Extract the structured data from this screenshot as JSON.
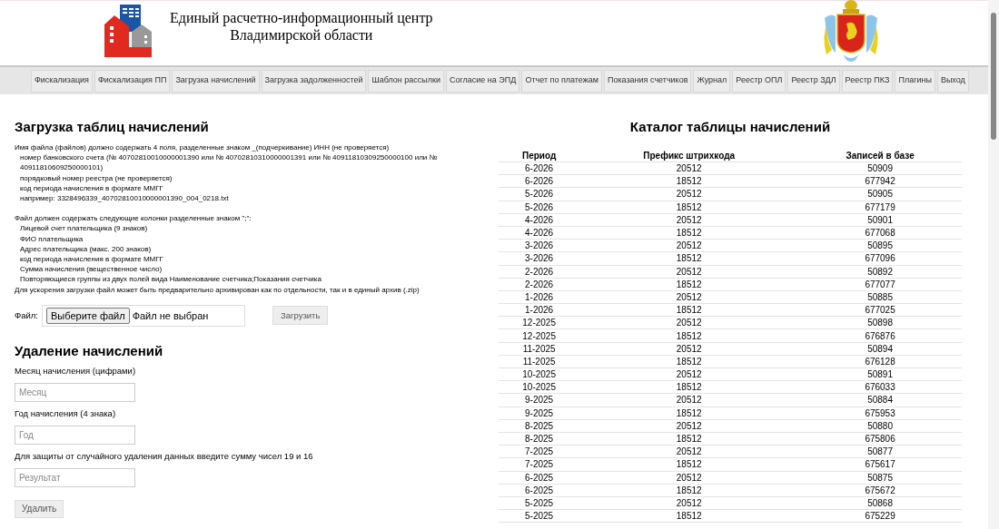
{
  "header": {
    "title_lines": [
      "Единый расчетно-информационный центр",
      "Владимирской области"
    ]
  },
  "nav": [
    {
      "label": "Фискализация"
    },
    {
      "label": "Фискализация ПП"
    },
    {
      "label": "Загрузка начислений"
    },
    {
      "label": "Загрузка задолженностей"
    },
    {
      "label": "Шаблон рассылки"
    },
    {
      "label": "Согласие на ЭПД"
    },
    {
      "label": "Отчет по платежам"
    },
    {
      "label": "Показания счетчиков"
    },
    {
      "label": "Журнал"
    },
    {
      "label": "Реестр ОПЛ"
    },
    {
      "label": "Реестр ЗДЛ"
    },
    {
      "label": "Реестр ПКЗ"
    },
    {
      "label": "Плагины"
    },
    {
      "label": "Выход"
    }
  ],
  "upload": {
    "title": "Загрузка таблиц начислений",
    "instructions": [
      [
        {
          "kind": "plain",
          "text": "Имя файла (файлов) должно содержать 4 поля, разделенные знаком _(подчеркивание)    ИНН (не проверяется)"
        },
        {
          "kind": "indented",
          "text": "номер банковского счета (№ 40702810010000001390 или № 40702810310000001391 или № 40911810309250000100 или № 40911810609250000101)"
        },
        {
          "kind": "indented",
          "text": "порядковый номер реестра (не проверяется)"
        },
        {
          "kind": "indented",
          "text": "код периода начисления в формате ММГГ"
        },
        {
          "kind": "indented",
          "text": "например: 3328496339_40702810010000001390_004_0218.txt"
        }
      ],
      [
        {
          "kind": "plain",
          "text": "Файл должен содержать следующие колонки разделенные знаком \";\":"
        },
        {
          "kind": "indented",
          "text": "Лицевой счет плательщика (9 знаков)"
        },
        {
          "kind": "indented",
          "text": "ФИО плательщика"
        },
        {
          "kind": "indented",
          "text": "Адрес плательщика (макс. 200 знаков)"
        },
        {
          "kind": "indented",
          "text": "код периода начисления в формате ММГГ"
        },
        {
          "kind": "indented",
          "text": "Сумма начисления (вещественное число)"
        },
        {
          "kind": "indented",
          "text": "Повторяющиеся группы из двух полей вида Наименование счетчика;Показания счетчика"
        },
        {
          "kind": "plain",
          "text": "Для ускорения загрузки файл может быть предварительно архивирован как по отдельности, так и в единый архив (.zip)"
        }
      ]
    ],
    "file_label": "Файл:",
    "choose_button": "Выберите файл",
    "file_status": "Файл не выбран",
    "submit_button": "Загрузить"
  },
  "delete": {
    "title": "Удаление начислений",
    "fields": [
      {
        "label": "Месяц начисления (цифрами)",
        "placeholder": "Месяц"
      },
      {
        "label": "Год начисления (4 знака)",
        "placeholder": "Год"
      },
      {
        "label": "Для защиты от случайного удаления данных введите сумму чисел 19 и 16",
        "placeholder": "Результат"
      }
    ],
    "button": "Удалить"
  },
  "catalog": {
    "title": "Каталог таблицы начислений",
    "columns": [
      "Период",
      "Префикс штрихкода",
      "Записей в базе"
    ],
    "rows": [
      [
        "6-2026",
        "20512",
        "50909"
      ],
      [
        "6-2026",
        "18512",
        "677942"
      ],
      [
        "5-2026",
        "20512",
        "50905"
      ],
      [
        "5-2026",
        "18512",
        "677179"
      ],
      [
        "4-2026",
        "20512",
        "50901"
      ],
      [
        "4-2026",
        "18512",
        "677068"
      ],
      [
        "3-2026",
        "20512",
        "50895"
      ],
      [
        "3-2026",
        "18512",
        "677096"
      ],
      [
        "2-2026",
        "20512",
        "50892"
      ],
      [
        "2-2026",
        "18512",
        "677077"
      ],
      [
        "1-2026",
        "20512",
        "50885"
      ],
      [
        "1-2026",
        "18512",
        "677025"
      ],
      [
        "12-2025",
        "20512",
        "50898"
      ],
      [
        "12-2025",
        "18512",
        "676876"
      ],
      [
        "11-2025",
        "20512",
        "50894"
      ],
      [
        "11-2025",
        "18512",
        "676128"
      ],
      [
        "10-2025",
        "20512",
        "50891"
      ],
      [
        "10-2025",
        "18512",
        "676033"
      ],
      [
        "9-2025",
        "20512",
        "50884"
      ],
      [
        "9-2025",
        "18512",
        "675953"
      ],
      [
        "8-2025",
        "20512",
        "50880"
      ],
      [
        "8-2025",
        "18512",
        "675806"
      ],
      [
        "7-2025",
        "20512",
        "50877"
      ],
      [
        "7-2025",
        "18512",
        "675617"
      ],
      [
        "6-2025",
        "20512",
        "50875"
      ],
      [
        "6-2025",
        "18512",
        "675672"
      ],
      [
        "5-2025",
        "20512",
        "50868"
      ],
      [
        "5-2025",
        "18512",
        "675229"
      ]
    ]
  }
}
